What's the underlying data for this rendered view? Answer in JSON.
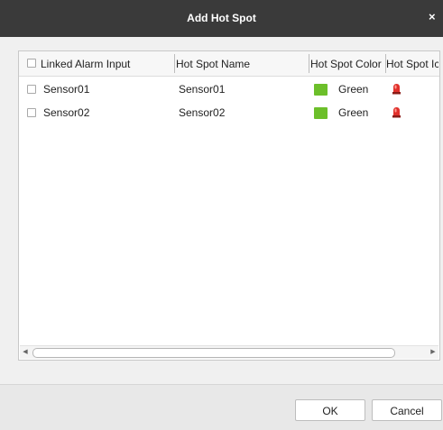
{
  "dialog": {
    "title": "Add Hot Spot",
    "close_glyph": "×"
  },
  "table": {
    "columns": [
      {
        "label": "Linked Alarm Input"
      },
      {
        "label": "Hot Spot Name"
      },
      {
        "label": "Hot Spot Color"
      },
      {
        "label": "Hot Spot Ic"
      }
    ],
    "rows": [
      {
        "input": "Sensor01",
        "name": "Sensor01",
        "color": "Green",
        "color_hex": "#6cbf2a",
        "icon": "alarm-light-icon",
        "checked": false
      },
      {
        "input": "Sensor02",
        "name": "Sensor02",
        "color": "Green",
        "color_hex": "#6cbf2a",
        "icon": "alarm-light-icon",
        "checked": false
      }
    ]
  },
  "scrollbar": {
    "left_glyph": "◀",
    "right_glyph": "▶"
  },
  "buttons": {
    "ok": "OK",
    "cancel": "Cancel"
  }
}
